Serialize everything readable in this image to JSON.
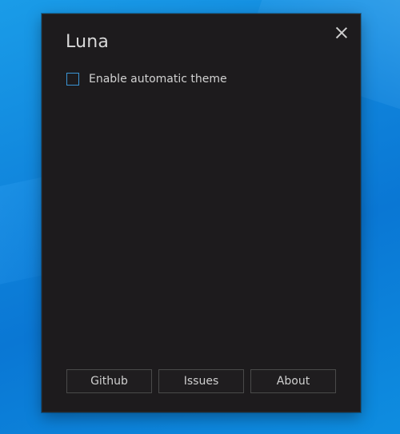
{
  "window": {
    "title": "Luna",
    "close_icon": "close-icon"
  },
  "settings": {
    "auto_theme_label": "Enable automatic theme",
    "auto_theme_checked": false
  },
  "buttons": {
    "github": "Github",
    "issues": "Issues",
    "about": "About"
  },
  "colors": {
    "window_bg": "#1d1b1d",
    "accent": "#3a94d4",
    "desktop_bg": "#1085dc"
  }
}
